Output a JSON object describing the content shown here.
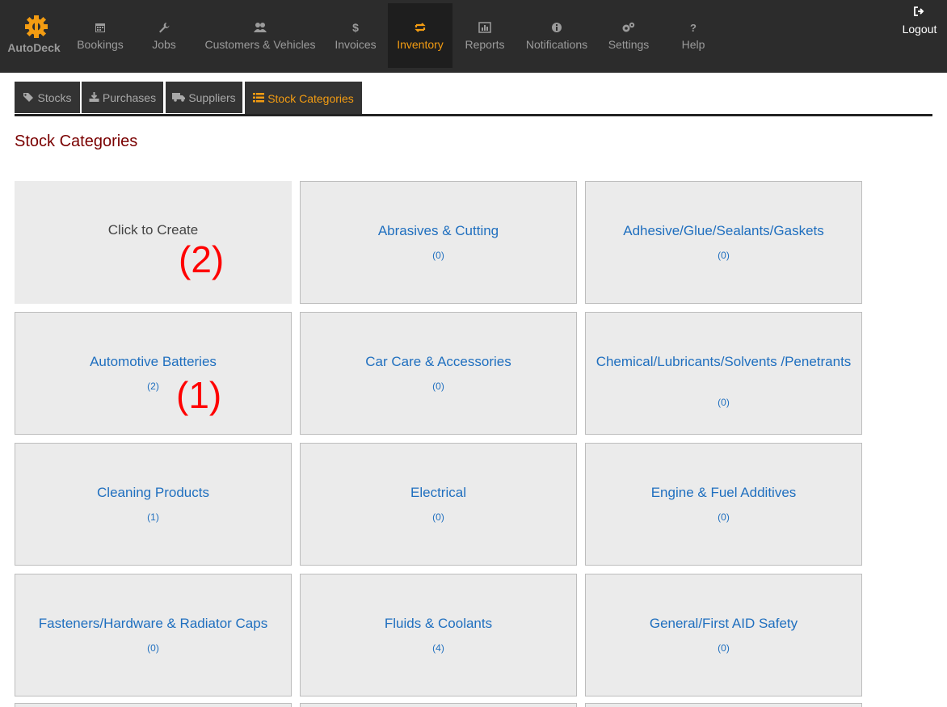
{
  "app": {
    "brand": "AutoDeck"
  },
  "nav": {
    "items": [
      {
        "label": "Bookings",
        "icon": "calendar-icon"
      },
      {
        "label": "Jobs",
        "icon": "wrench-icon"
      },
      {
        "label": "Customers & Vehicles",
        "icon": "users-icon"
      },
      {
        "label": "Invoices",
        "icon": "dollar-icon"
      },
      {
        "label": "Inventory",
        "icon": "exchange-icon",
        "active": true
      },
      {
        "label": "Reports",
        "icon": "bar-chart-icon"
      },
      {
        "label": "Notifications",
        "icon": "info-icon"
      },
      {
        "label": "Settings",
        "icon": "cogs-icon"
      },
      {
        "label": "Help",
        "icon": "question-icon"
      }
    ],
    "logout": "Logout"
  },
  "subtabs": [
    {
      "label": "Stocks",
      "icon": "tags-icon"
    },
    {
      "label": "Purchases",
      "icon": "download-icon"
    },
    {
      "label": "Suppliers",
      "icon": "truck-icon"
    },
    {
      "label": "Stock Categories",
      "icon": "list-icon",
      "active": true
    }
  ],
  "page": {
    "title": "Stock Categories"
  },
  "create_card": {
    "label": "Click to Create"
  },
  "categories": [
    {
      "name": "Abrasives & Cutting",
      "count": "(0)"
    },
    {
      "name": "Adhesive/Glue/Sealants/Gaskets",
      "count": "(0)"
    },
    {
      "name": "Automotive Batteries",
      "count": "(2)"
    },
    {
      "name": "Car Care & Accessories",
      "count": "(0)"
    },
    {
      "name": "Chemical/Lubricants/Solvents /Penetrants",
      "count": "(0)"
    },
    {
      "name": "Cleaning Products",
      "count": "(1)"
    },
    {
      "name": "Electrical",
      "count": "(0)"
    },
    {
      "name": "Engine & Fuel Additives",
      "count": "(0)"
    },
    {
      "name": "Fasteners/Hardware & Radiator Caps",
      "count": "(0)"
    },
    {
      "name": "Fluids & Coolants",
      "count": "(4)"
    },
    {
      "name": "General/First AID Safety",
      "count": "(0)"
    }
  ],
  "annotations": {
    "create": "(2)",
    "batteries": "(1)"
  },
  "colors": {
    "accent": "#f39c12",
    "link": "#1f6fbf",
    "title": "#7a0000",
    "annotation": "#ff0000",
    "nav_bg": "#2c2c2c"
  }
}
